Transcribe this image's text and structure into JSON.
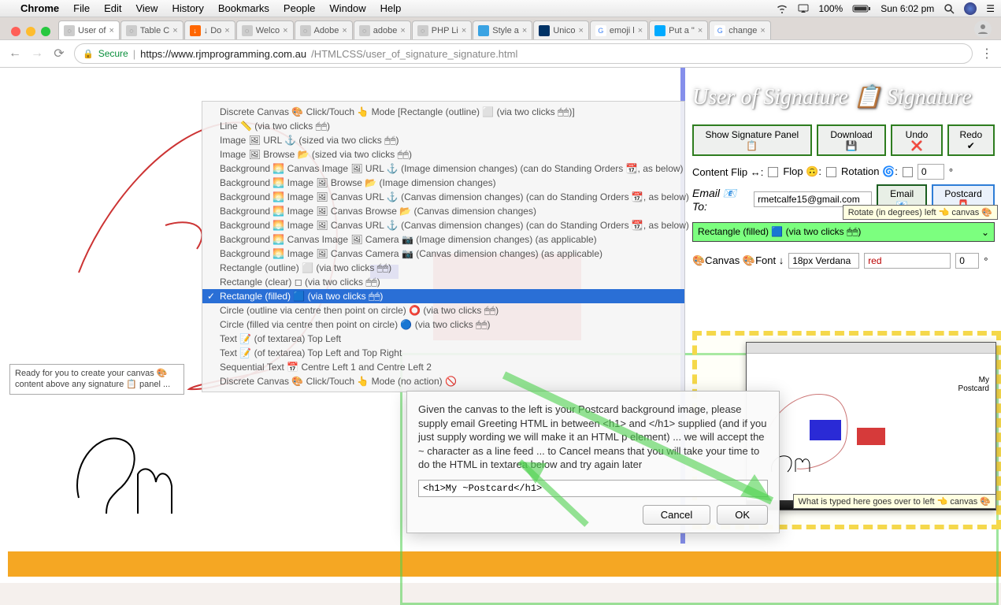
{
  "menubar": {
    "app": "Chrome",
    "items": [
      "File",
      "Edit",
      "View",
      "History",
      "Bookmarks",
      "People",
      "Window",
      "Help"
    ],
    "battery": "100%",
    "clock": "Sun 6:02 pm"
  },
  "tabs": [
    {
      "label": "User of",
      "active": true
    },
    {
      "label": "Table C"
    },
    {
      "label": "↓ Do"
    },
    {
      "label": "Welco"
    },
    {
      "label": "Adobe"
    },
    {
      "label": "adobe"
    },
    {
      "label": "PHP Li"
    },
    {
      "label": "Style a"
    },
    {
      "label": "Unico"
    },
    {
      "label": "emoji l"
    },
    {
      "label": "Put a \""
    },
    {
      "label": "change"
    }
  ],
  "omnibox": {
    "secure": "Secure",
    "host": "https://www.rjmprogramming.com.au",
    "path": "/HTMLCSS/user_of_signature_signature.html"
  },
  "dropdown": {
    "options": [
      "Discrete Canvas 🎨 Click/Touch 👆 Mode [Rectangle (outline) ⬜ (via two clicks 🖱🖱)]",
      "Line 📏 (via two clicks 🖱🖱)",
      "Image 🖼 URL ⚓ (sized via two clicks 🖱🖱)",
      "Image 🖼 Browse 📂 (sized via two clicks 🖱🖱)",
      "Background 🌅 Canvas Image 🖼 URL ⚓ (Image dimension changes) (can do Standing Orders 📆, as below)",
      "Background 🌅 Image 🖼 Browse 📂 (Image dimension changes)",
      "Background 🌅 Image 🖼 Canvas URL ⚓ (Canvas dimension changes) (can do Standing Orders 📆, as below)",
      "Background 🌅 Image 🖼 Canvas Browse 📂 (Canvas dimension changes)",
      "Background 🌅 Image 🖼 Canvas URL ⚓ (Canvas dimension changes) (can do Standing Orders 📆, as below)",
      "Background 🌅 Canvas Image 🖼 Camera 📷 (Image dimension changes) (as applicable)",
      "Background 🌅 Image 🖼 Canvas Camera 📷 (Canvas dimension changes) (as applicable)",
      "Rectangle (outline) ⬜ (via two clicks 🖱🖱)",
      "Rectangle (clear) ◻ (via two clicks 🖱🖱)",
      "Rectangle (filled) 🟦 (via two clicks 🖱🖱)",
      "Circle (outline via centre then point on circle) ⭕ (via two clicks 🖱🖱)",
      "Circle (filled via centre then point on circle) 🔵 (via two clicks 🖱🖱)",
      "Text 📝 (of textarea) Top Left",
      "Text 📝 (of textarea) Top Left and Top Right",
      "Sequential Text 📅 Centre Left 1 and Centre Left 2",
      "Discrete Canvas 🎨 Click/Touch 👆 Mode (no action) 🚫"
    ],
    "selected_index": 13
  },
  "info_box": "Ready for you to create your canvas 🎨 content above any signature 📋 panel ...",
  "right": {
    "title": "User of Signature 📋 Signature",
    "buttons": {
      "show": "Show Signature Panel 📋",
      "download": "Download 💾",
      "undo": "Undo ❌",
      "redo": "Redo ✔"
    },
    "flip_label": "Content Flip ↔:",
    "flop_label": "Flop 🙃:",
    "rotation_label": "Rotation 🌀:",
    "rotation_value": "0",
    "rotation_tip": "Rotate (in degrees) left 👈 canvas 🎨",
    "email_label": "Email 📧 To:",
    "email_value": "rmetcalfe15@gmail.com",
    "email_btn": "Email 📧",
    "postcard_btn": "Postcard 📮",
    "mode_select": "Rectangle (filled) 🟦 (via two clicks 🖱🖱)",
    "canvas_font": "🎨Canvas 🎨Font ↓",
    "font_value": "18px Verdana",
    "color_value": "red",
    "num_value": "0"
  },
  "modal": {
    "body": "Given the canvas to the left is your Postcard background image, please supply email Greeting HTML in between <h1> and </h1> supplied (and if you just supply wording we will make it an HTML p element) ... we will accept the ~ character as a line feed ... to Cancel means that you will take your time to do the HTML in textarea below and try again later",
    "input": "<h1>My ~Postcard</h1>",
    "cancel": "Cancel",
    "ok": "OK"
  },
  "preview": {
    "title_l1": "My",
    "title_l2": "Postcard"
  },
  "hint2": "What is typed here goes over to left 👈 canvas 🎨"
}
